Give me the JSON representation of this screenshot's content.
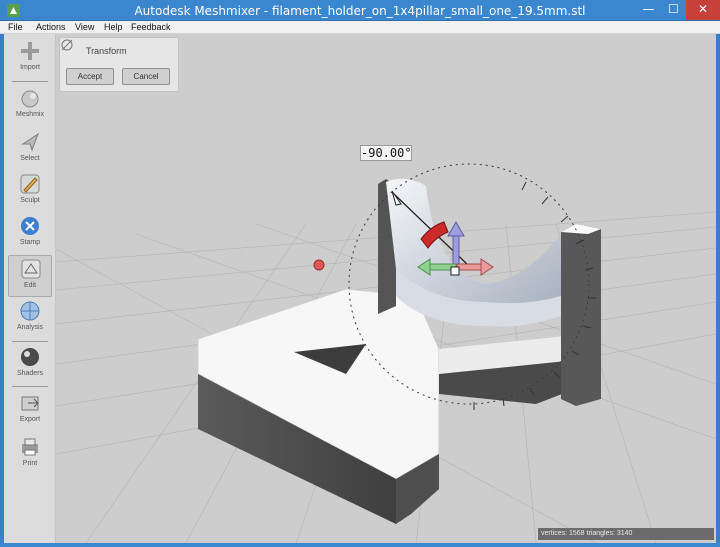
{
  "window": {
    "title": "Autodesk Meshmixer - filament_holder_on_1x4pillar_small_one_19.5mm.stl",
    "minimize": "—",
    "maximize": "☐",
    "close": "✕"
  },
  "menu": [
    "File",
    "Actions",
    "View",
    "Help",
    "Feedback"
  ],
  "toolbar": {
    "items": [
      {
        "label": "Import",
        "icon": "plus-icon"
      },
      {
        "label": "Meshmix",
        "icon": "bunny-icon"
      },
      {
        "label": "Select",
        "icon": "arrow-cursor-icon"
      },
      {
        "label": "Sculpt",
        "icon": "brush-icon"
      },
      {
        "label": "Stamp",
        "icon": "stamp-icon"
      },
      {
        "label": "Edit",
        "icon": "edit-icon",
        "active": true
      },
      {
        "label": "Analysis",
        "icon": "analysis-icon"
      },
      {
        "label": "Shaders",
        "icon": "sphere-icon"
      },
      {
        "label": "Export",
        "icon": "export-icon"
      },
      {
        "label": "Print",
        "icon": "printer-icon"
      }
    ]
  },
  "panel": {
    "title": "Transform",
    "accept_label": "Accept",
    "cancel_label": "Cancel"
  },
  "viewport": {
    "angle_readout": "-90.00°"
  },
  "status": {
    "text": "vertices: 1568 triangles: 3140"
  },
  "colors": {
    "titlebar": "#3a86cf",
    "viewport_bg": "#cdcdcd",
    "gizmo_red": "#d33a3a",
    "gizmo_green": "#7bc47b",
    "gizmo_blue": "#8f8fd6"
  }
}
